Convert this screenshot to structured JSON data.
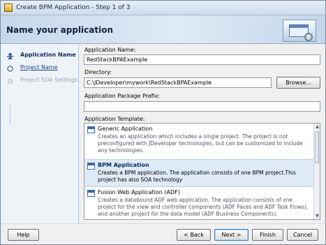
{
  "window": {
    "title": "Create BPM Application - Step 1 of 3"
  },
  "header": {
    "title": "Name your application"
  },
  "nav": {
    "items": [
      {
        "label": "Application Name"
      },
      {
        "label": "Project Name"
      },
      {
        "label": "Project SOA Settings"
      }
    ]
  },
  "form": {
    "app_name_label": "Application Name:",
    "app_name_value": "RedStackBPAExample",
    "directory_label": "Directory:",
    "directory_value": "C:\\JDeveloper\\mywork\\RedStackBPAExample",
    "browse_label": "Browse...",
    "package_prefix_label": "Application Package Prefix:",
    "package_prefix_value": "",
    "template_label": "Application Template:"
  },
  "templates": [
    {
      "name": "Generic Application",
      "description": "Creates an application which includes a single project. The project is not preconfigured with JDeveloper technologies, but can be customized to include any technologies."
    },
    {
      "name": "BPM Application",
      "description": "Creates a BPM application. The application consists of one BPM project.This project has also SOA technology"
    },
    {
      "name": "Fusion Web Application (ADF)",
      "description": "Creates a databound ADF web application. The application consists of one project for the view and controller components (ADF Faces and ADF Task Flows), and another project for the data model (ADF Business Components)."
    }
  ],
  "footer": {
    "help_label": "Help",
    "back_label": "< Back",
    "next_label": "Next >",
    "finish_label": "Finish",
    "cancel_label": "Cancel"
  }
}
